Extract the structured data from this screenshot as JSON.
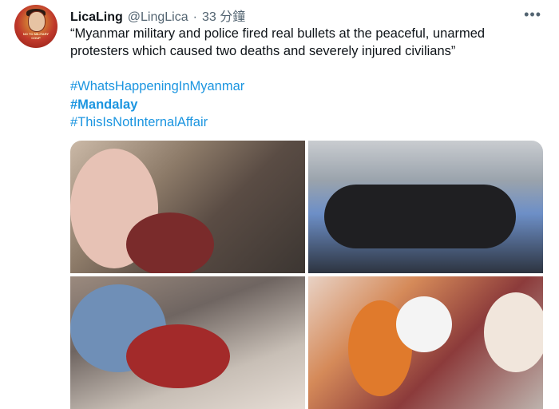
{
  "tweet": {
    "author_name": "LicaLing",
    "handle": "@LingLica",
    "separator": "·",
    "time": "33 分鐘",
    "more_label": "•••",
    "avatar_caption": "NO TO MILITARY COUP",
    "text": "“Myanmar military and police fired real bullets at the peaceful, unarmed protesters which caused two deaths and severely injured civilians”",
    "hashtags": [
      "#WhatsHappeningInMyanmar",
      "#Mandalay",
      "#ThisIsNotInternalAffair"
    ]
  },
  "colors": {
    "link": "#1b95e0",
    "secondary_text": "#536471"
  }
}
